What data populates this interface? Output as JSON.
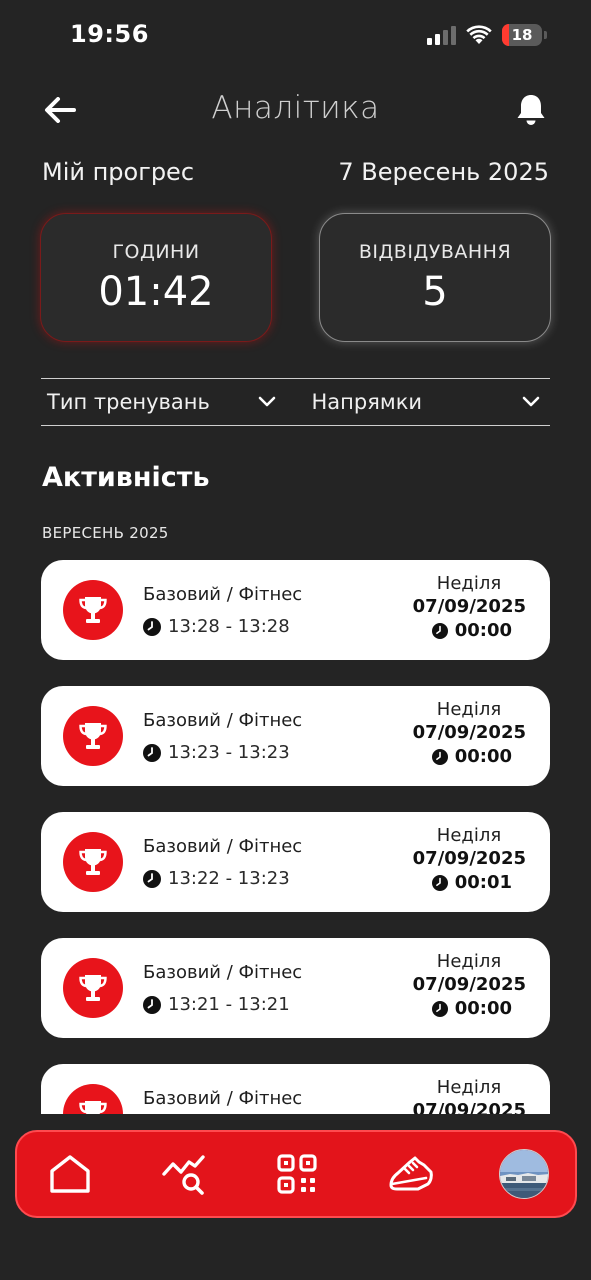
{
  "status_bar": {
    "time": "19:56",
    "battery": "18",
    "battery_level": 0.18
  },
  "header": {
    "title": "Аналітика"
  },
  "progress": {
    "label": "Мій прогрес",
    "date": "7 Вересень 2025"
  },
  "stats": {
    "hours": {
      "label": "ГОДИНИ",
      "value": "01:42"
    },
    "visits": {
      "label": "ВІДВІДУВАННЯ",
      "value": "5"
    }
  },
  "filters": [
    {
      "label": "Тип тренувань"
    },
    {
      "label": "Напрямки"
    }
  ],
  "activity": {
    "title": "Активність",
    "month": "ВЕРЕСЕНЬ 2025",
    "items": [
      {
        "name": "Базовий / Фітнес",
        "time_range": "13:28 - 13:28",
        "day": "Неділя",
        "date": "07/09/2025",
        "duration": "00:00"
      },
      {
        "name": "Базовий / Фітнес",
        "time_range": "13:23 - 13:23",
        "day": "Неділя",
        "date": "07/09/2025",
        "duration": "00:00"
      },
      {
        "name": "Базовий / Фітнес",
        "time_range": "13:22 - 13:23",
        "day": "Неділя",
        "date": "07/09/2025",
        "duration": "00:01"
      },
      {
        "name": "Базовий / Фітнес",
        "time_range": "13:21 - 13:21",
        "day": "Неділя",
        "date": "07/09/2025",
        "duration": "00:00"
      },
      {
        "name": "Базовий / Фітнес",
        "time_range": "",
        "day": "Неділя",
        "date": "07/09/2025",
        "duration": ""
      }
    ]
  },
  "nav": {
    "items": [
      {
        "icon": "home-icon"
      },
      {
        "icon": "analytics-search-icon"
      },
      {
        "icon": "qr-code-icon"
      },
      {
        "icon": "sneaker-icon"
      },
      {
        "icon": "profile-avatar"
      }
    ]
  },
  "colors": {
    "accent": "#e3141b",
    "background": "#242424",
    "card": "#ffffff"
  }
}
